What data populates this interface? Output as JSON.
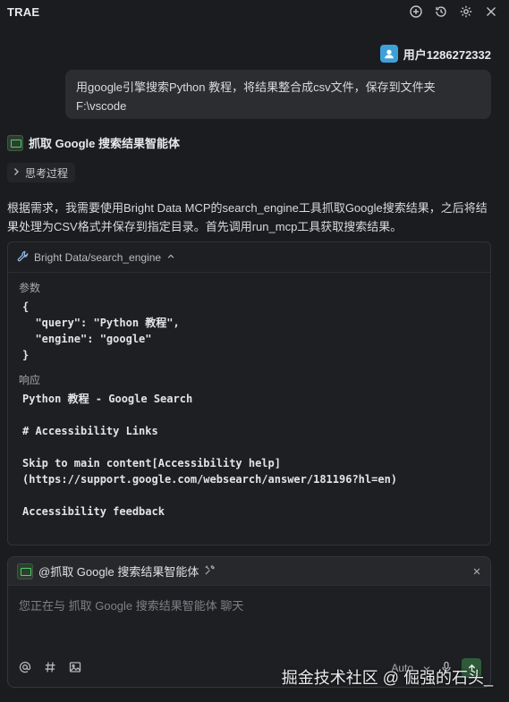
{
  "app": {
    "title": "TRAE"
  },
  "titlebar": {
    "icons": [
      "new-chat-icon",
      "history-icon",
      "gear-icon",
      "close-icon"
    ]
  },
  "user": {
    "name": "用户1286272332"
  },
  "user_message": {
    "text": "用google引擎搜索Python 教程，将结果整合成csv文件，保存到文件夹F:\\vscode"
  },
  "agent": {
    "name": "抓取 Google 搜索结果智能体"
  },
  "thinking": {
    "label": "思考过程"
  },
  "answer": {
    "text": "根据需求，我需要使用Bright Data MCP的search_engine工具抓取Google搜索结果，之后将结果处理为CSV格式并保存到指定目录。首先调用run_mcp工具获取搜索结果。"
  },
  "tool_call": {
    "name": "Bright Data/search_engine",
    "params_label": "参数",
    "params_code": "{\n  \"query\": \"Python 教程\",\n  \"engine\": \"google\"\n}",
    "response_label": "响应",
    "response_code": "Python 教程 - Google Search\n\n# Accessibility Links\n\nSkip to main content[Accessibility help]\n(https://support.google.com/websearch/answer/181196?hl=en)\n\nAccessibility feedback"
  },
  "composer": {
    "agent_mention": "@抓取 Google 搜索结果智能体",
    "placeholder": "您正在与 抓取 Google 搜索结果智能体 聊天",
    "mode": "Auto"
  },
  "watermark": {
    "text": "掘金技术社区 @ 倔强的石头_"
  }
}
